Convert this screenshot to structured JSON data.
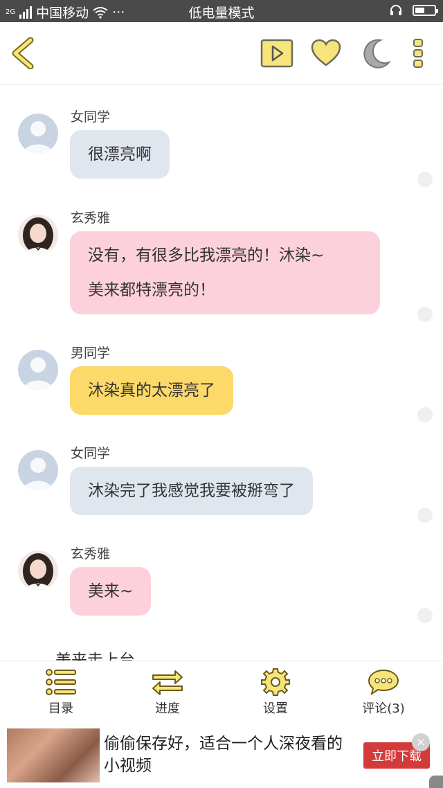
{
  "status_bar": {
    "network_type": "2G",
    "carrier": "中国移动",
    "more": "···",
    "mode": "低电量模式",
    "battery_level": 0.5
  },
  "toolbar": {
    "back": "chevron-left-icon",
    "play": "play-icon",
    "like": "heart-icon",
    "night": "moon-icon",
    "more": "more-vertical-icon"
  },
  "messages": [
    {
      "sender": "女同学",
      "text": "很漂亮啊",
      "avatar": "default",
      "color": "#dfe6ee"
    },
    {
      "sender": "玄秀雅",
      "text_lines": [
        "没有，有很多比我漂亮的！沐染~",
        "美来都特漂亮的！"
      ],
      "avatar": "photo",
      "color": "#fdd1dc"
    },
    {
      "sender": "男同学",
      "text": "沐染真的太漂亮了",
      "avatar": "default",
      "color": "#fdd96a"
    },
    {
      "sender": "女同学",
      "text": "沐染完了我感觉我要被掰弯了",
      "avatar": "default",
      "color": "#dfe6ee"
    },
    {
      "sender": "玄秀雅",
      "text": "美来~",
      "avatar": "photo",
      "color": "#fdd1dc"
    }
  ],
  "partial_text": "美来走上台",
  "bottom_nav": [
    {
      "label": "目录",
      "icon": "list-icon"
    },
    {
      "label": "进度",
      "icon": "swap-arrows-icon"
    },
    {
      "label": "设置",
      "icon": "gear-icon"
    },
    {
      "label": "评论(3)",
      "icon": "chat-bubble-icon"
    }
  ],
  "ad": {
    "text": "偷偷保存好，适合一个人深夜看的小视频",
    "button": "立即下载",
    "close": "×"
  },
  "colors": {
    "accent_yellow": "#f7e47a",
    "icon_stroke": "#6b5a1a",
    "ad_button": "#d33a3a"
  }
}
